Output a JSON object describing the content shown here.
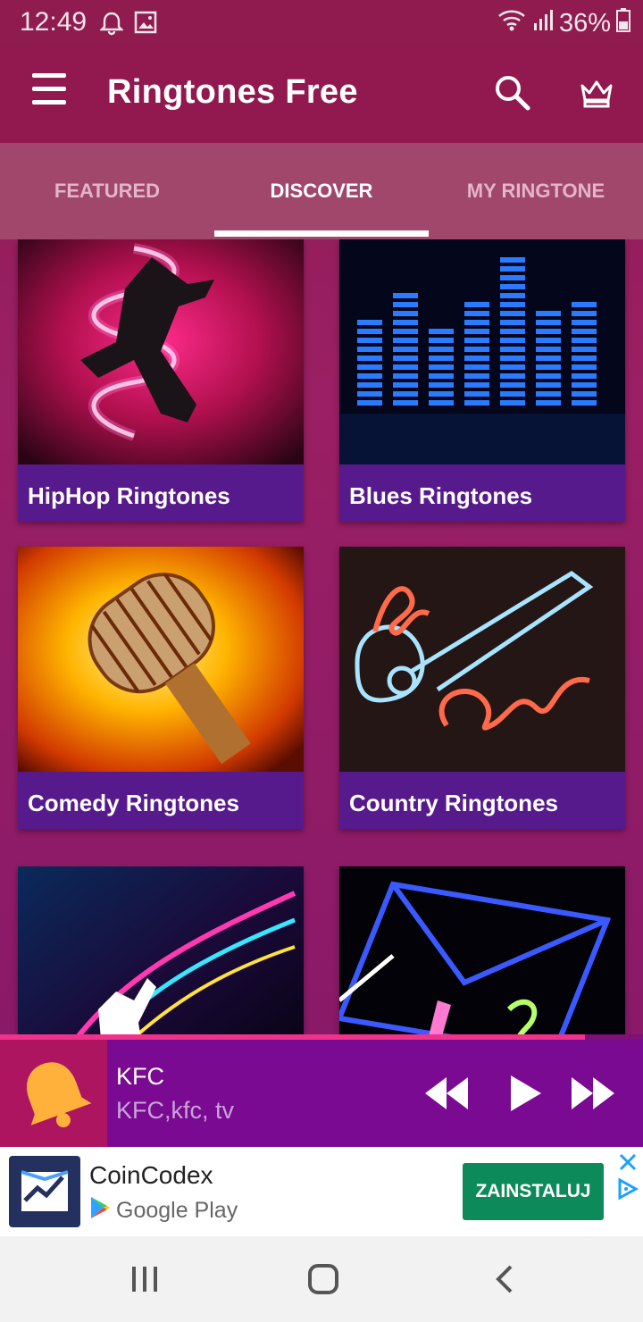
{
  "status_bar": {
    "time": "12:49",
    "battery": "36%",
    "icons": [
      "bell-icon",
      "image-icon",
      "wifi-icon",
      "signal-icon",
      "battery-icon"
    ]
  },
  "app_bar": {
    "title": "Ringtones Free",
    "icons": [
      "menu-icon",
      "search-icon",
      "crown-icon"
    ]
  },
  "tabs": [
    {
      "label": "FEATURED",
      "active": false
    },
    {
      "label": "DISCOVER",
      "active": true
    },
    {
      "label": "MY RINGTONE",
      "active": false
    }
  ],
  "categories": [
    {
      "label": "HipHop Ringtones"
    },
    {
      "label": "Blues Ringtones"
    },
    {
      "label": "Comedy Ringtones"
    },
    {
      "label": "Country Ringtones"
    },
    {
      "label": ""
    },
    {
      "label": ""
    }
  ],
  "player": {
    "title": "KFC",
    "subtitle": "KFC,kfc, tv",
    "progress": 0.91,
    "icons": [
      "bell-icon",
      "rewind-icon",
      "play-icon",
      "fast-forward-icon"
    ]
  },
  "ad": {
    "title": "CoinCodex",
    "store": "Google Play",
    "cta": "ZAINSTALUJ"
  },
  "colors": {
    "accent": "#f0338a",
    "app_bar": "#91194f",
    "player": "#7a0a91",
    "card_label": "#561a8d",
    "cta": "#0d8a5a"
  }
}
